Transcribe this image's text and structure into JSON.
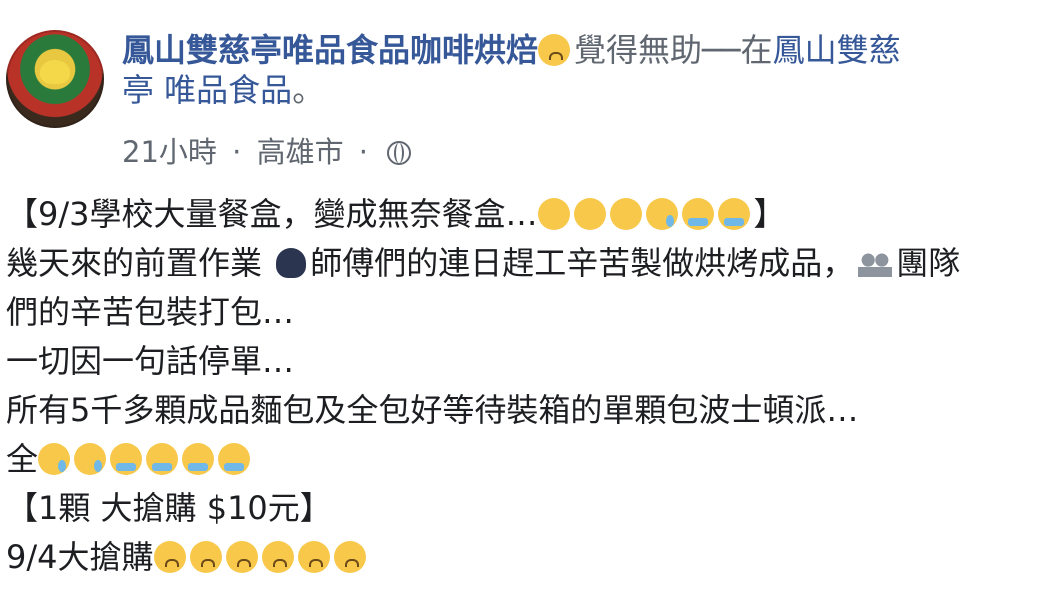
{
  "post": {
    "page_name": "鳳山雙慈亭唯品食品咖啡烘焙",
    "activity_text": "覺得無助──在",
    "location_link": "鳳山雙慈",
    "location_link_cont": "亭 唯品食品",
    "location_suffix": "。",
    "time": "21小時",
    "separator": "·",
    "place": "高雄市",
    "privacy_icon": "globe-icon",
    "lines": {
      "l1_prefix": "【9/3學校大量餐盒，變成無奈餐盒…",
      "l1_suffix": "】",
      "l2_a": "幾天來的前置作業 ",
      "l2_b": "師傅們的連日趕工辛苦製做烘烤成品，",
      "l2_c": "團隊",
      "l3": "們的辛苦包裝打包…",
      "l4": "一切因一句話停單…",
      "l5": "所有5千多顆成品麵包及全包好等待裝箱的單顆包波士頓派…",
      "l6": "全",
      "l7": "【1顆 大搶購 $10元】",
      "l8": "9/4大搶購"
    }
  }
}
